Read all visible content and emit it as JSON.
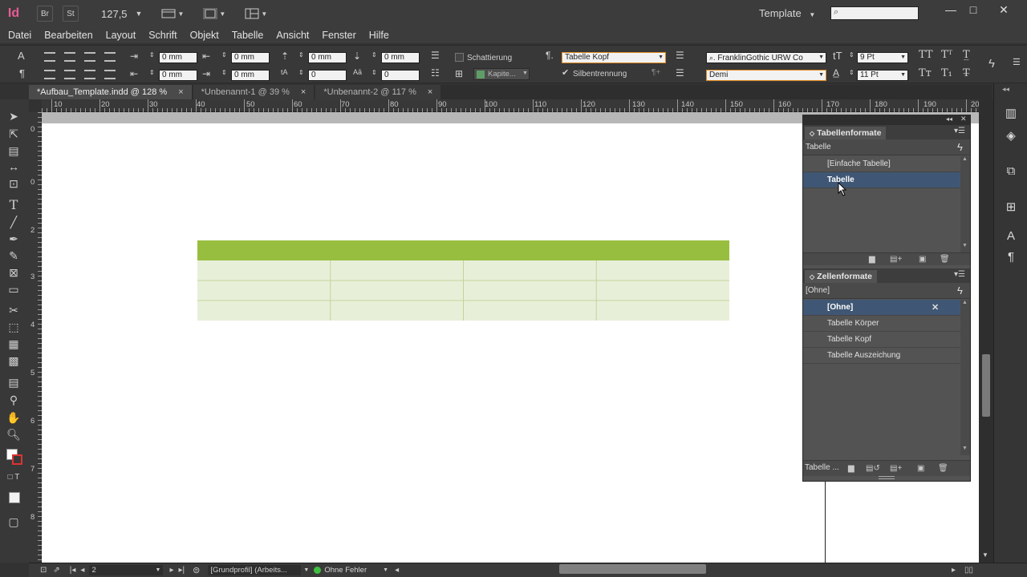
{
  "app": {
    "logo": "Id",
    "bridge_label": "Br",
    "stock_label": "St",
    "zoom": "127,5",
    "workspace": "Template",
    "window_minimize": "—",
    "window_maximize": "□",
    "window_close": "✕"
  },
  "menu": [
    "Datei",
    "Bearbeiten",
    "Layout",
    "Schrift",
    "Objekt",
    "Tabelle",
    "Ansicht",
    "Fenster",
    "Hilfe"
  ],
  "control": {
    "indent_left": "0 mm",
    "indent_right": "0 mm",
    "first_line_indent": "0 mm",
    "last_line_indent": "0 mm",
    "space_before": "0 mm",
    "space_after": "0 mm",
    "drop_cap_lines": "0",
    "drop_cap_chars": "0",
    "shading_label": "Schattierung",
    "shading_color": "Kapite...",
    "paragraph_style": "Tabelle Kopf",
    "hyphenation_label": "Silbentrennung",
    "hyphenation_checked": true,
    "font_family": "FranklinGothic URW Co",
    "font_style": "Demi",
    "font_size": "9 Pt",
    "leading": "11 Pt"
  },
  "tabs": [
    {
      "label": "*Aufbau_Template.indd @ 128 %",
      "active": true
    },
    {
      "label": "*Unbenannt-1 @ 39 %",
      "active": false
    },
    {
      "label": "*Unbenannt-2 @ 117 %",
      "active": false
    }
  ],
  "tab_close": "×",
  "ruler_h": [
    "10",
    "20",
    "30",
    "40",
    "50",
    "60",
    "70",
    "80",
    "90",
    "100",
    "110",
    "120",
    "130",
    "140",
    "150",
    "160",
    "170",
    "180",
    "190",
    "20"
  ],
  "ruler_v": [
    "0",
    "0",
    "2",
    "3",
    "4",
    "5",
    "6",
    "7",
    "8"
  ],
  "table": {
    "rows": 4,
    "columns": 4,
    "header_color": "#98be3f",
    "body_color": "#e8efd9",
    "line_color": "#c3d49a"
  },
  "panel_table_styles": {
    "title": "Tabellenformate",
    "current": "Tabelle",
    "items": [
      {
        "label": "[Einfache Tabelle]",
        "selected": false
      },
      {
        "label": "Tabelle",
        "selected": true
      }
    ]
  },
  "panel_cell_styles": {
    "title": "Zellenformate",
    "current": "[Ohne]",
    "items": [
      {
        "label": "[Ohne]",
        "selected": true
      },
      {
        "label": "Tabelle Körper",
        "selected": false
      },
      {
        "label": "Tabelle Kopf",
        "selected": false
      },
      {
        "label": "Tabelle Auszeichung",
        "selected": false
      }
    ],
    "footer_label": "Tabelle ..."
  },
  "status": {
    "page": "2",
    "profile": "[Grundprofil] (Arbeits...",
    "preflight": "Ohne Fehler",
    "preflight_color": "#3fbf3f"
  },
  "colors": {
    "accent_selected": "#3f5774",
    "logo": "#e85b96",
    "focus_outline": "#e08a1e"
  }
}
